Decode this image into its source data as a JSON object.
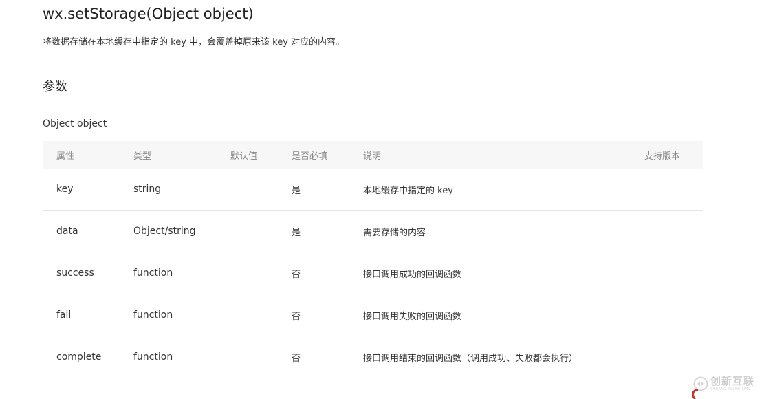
{
  "header": {
    "title": "wx.setStorage(Object object)",
    "description": "将数据存储在本地缓存中指定的 key 中，会覆盖掉原来该 key 对应的内容。"
  },
  "params": {
    "heading": "参数",
    "object_label": "Object object",
    "table": {
      "columns": [
        "属性",
        "类型",
        "默认值",
        "是否必填",
        "说明",
        "支持版本"
      ],
      "rows": [
        {
          "name": "key",
          "type": "string",
          "default": "",
          "required": "是",
          "description": "本地缓存中指定的 key",
          "version": ""
        },
        {
          "name": "data",
          "type": "Object/string",
          "default": "",
          "required": "是",
          "description": "需要存储的内容",
          "version": ""
        },
        {
          "name": "success",
          "type": "function",
          "default": "",
          "required": "否",
          "description": "接口调用成功的回调函数",
          "version": ""
        },
        {
          "name": "fail",
          "type": "function",
          "default": "",
          "required": "否",
          "description": "接口调用失败的回调函数",
          "version": ""
        },
        {
          "name": "complete",
          "type": "function",
          "default": "",
          "required": "否",
          "description": "接口调用结束的回调函数（调用成功、失败都会执行）",
          "version": ""
        }
      ]
    }
  },
  "watermark": {
    "brand": "创新互联",
    "sub": "CHUANG XIN HU LIAN",
    "accent_color": "#c0392b"
  }
}
